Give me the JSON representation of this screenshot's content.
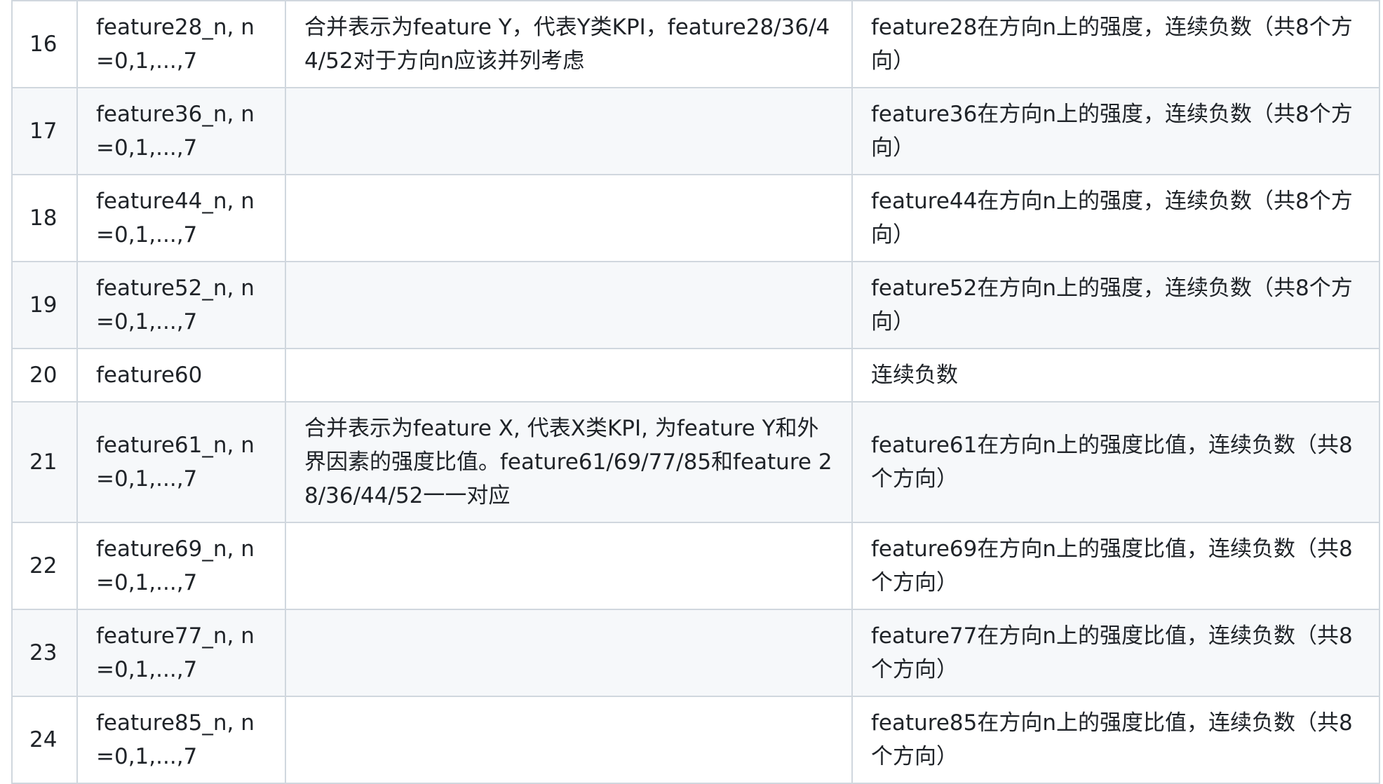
{
  "table": {
    "rows": [
      {
        "idx": "16",
        "name": "feature28_n, n=0,1,...,7",
        "merge": "合并表示为feature Y，代表Y类KPI，feature28/36/44/52对于方向n应该并列考虑",
        "desc": "feature28在方向n上的强度，连续负数（共8个方向）"
      },
      {
        "idx": "17",
        "name": "feature36_n, n=0,1,...,7",
        "merge": "",
        "desc": "feature36在方向n上的强度，连续负数（共8个方向）"
      },
      {
        "idx": "18",
        "name": "feature44_n, n=0,1,...,7",
        "merge": "",
        "desc": "feature44在方向n上的强度，连续负数（共8个方向）"
      },
      {
        "idx": "19",
        "name": "feature52_n, n=0,1,...,7",
        "merge": "",
        "desc": "feature52在方向n上的强度，连续负数（共8个方向）"
      },
      {
        "idx": "20",
        "name": "feature60",
        "merge": "",
        "desc": "连续负数"
      },
      {
        "idx": "21",
        "name": "feature61_n, n=0,1,...,7",
        "merge": "合并表示为feature X, 代表X类KPI, 为feature Y和外界因素的强度比值。feature61/69/77/85和feature 28/36/44/52一一对应",
        "desc": "feature61在方向n上的强度比值，连续负数（共8个方向）"
      },
      {
        "idx": "22",
        "name": "feature69_n, n=0,1,...,7",
        "merge": "",
        "desc": "feature69在方向n上的强度比值，连续负数（共8个方向）"
      },
      {
        "idx": "23",
        "name": "feature77_n, n=0,1,...,7",
        "merge": "",
        "desc": "feature77在方向n上的强度比值，连续负数（共8个方向）"
      },
      {
        "idx": "24",
        "name": "feature85_n, n=0,1,...,7",
        "merge": "",
        "desc": "feature85在方向n上的强度比值，连续负数（共8个方向）"
      }
    ]
  }
}
